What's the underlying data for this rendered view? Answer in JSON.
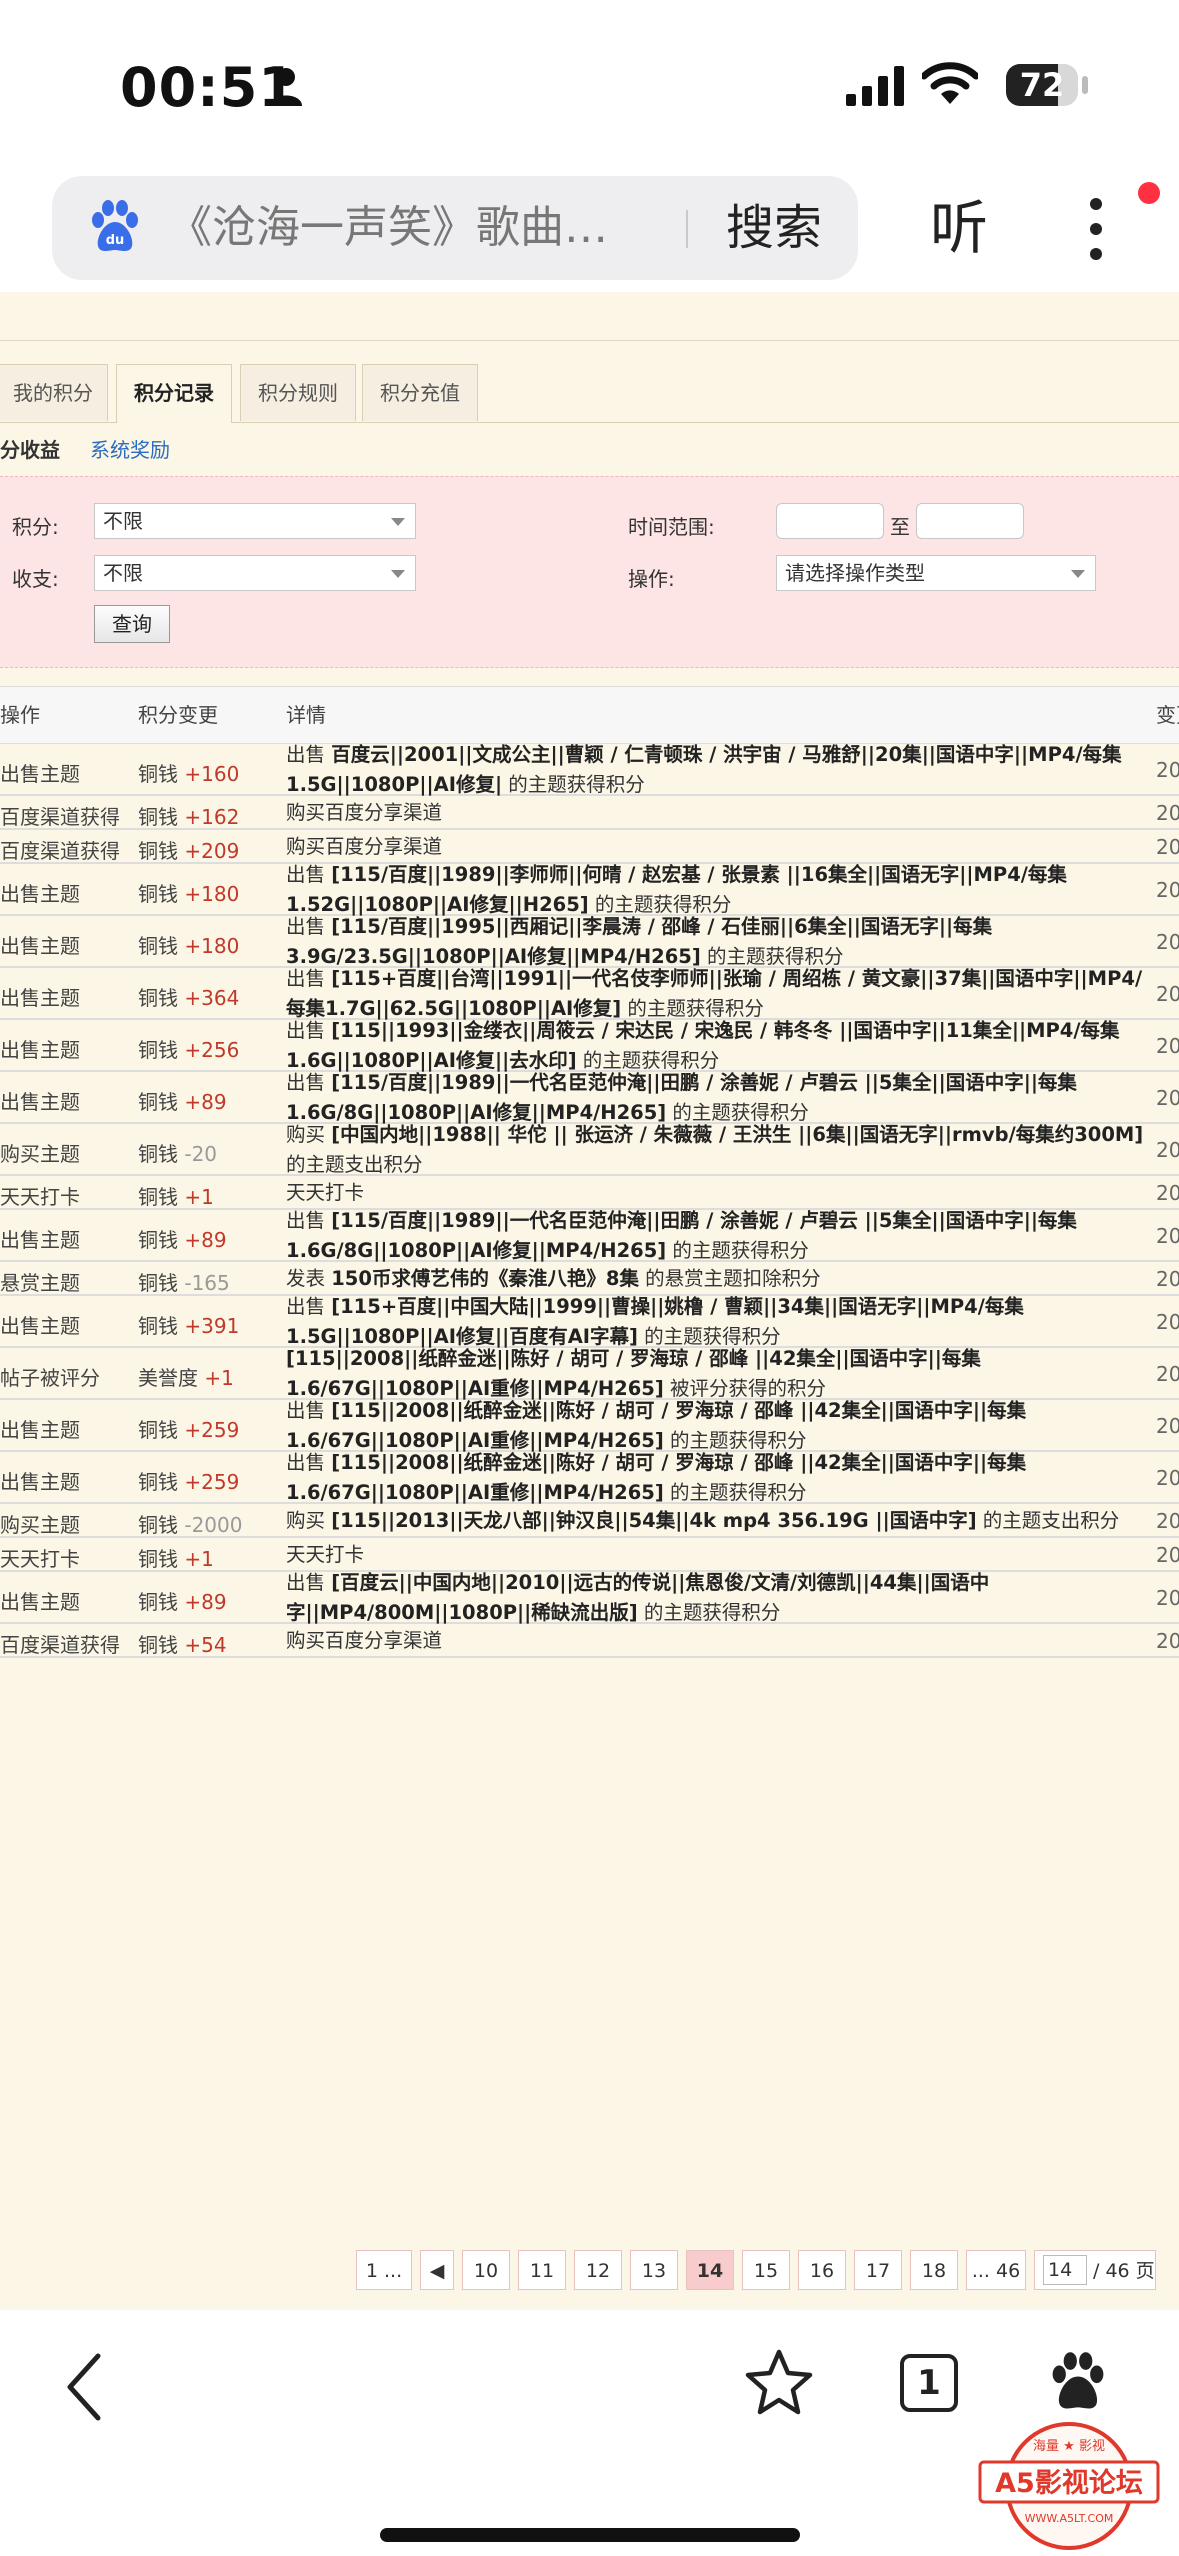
{
  "status_bar": {
    "time": "00:51",
    "battery": "72",
    "battery_level": 0.72
  },
  "browser": {
    "search_query": "《沧海一声笑》歌曲…",
    "search_button": "搜索",
    "listen_button": "听",
    "tab_count": "1"
  },
  "tabs": [
    {
      "label": "我的积分"
    },
    {
      "label": "积分记录"
    },
    {
      "label": "积分规则"
    },
    {
      "label": "积分充值"
    }
  ],
  "subtabs": {
    "income": "分收益",
    "system_reward": "系统奖励"
  },
  "filters": {
    "score_label": "积分:",
    "score_value": "不限",
    "inout_label": "收支:",
    "inout_value": "不限",
    "time_range_label": "时间范围:",
    "time_to": "至",
    "operation_label": "操作:",
    "operation_value": "请选择操作类型",
    "query_button": "查询"
  },
  "table": {
    "headers": {
      "op": "操作",
      "change": "积分变更",
      "detail": "详情",
      "time": "变更"
    },
    "rows": [
      {
        "op": "出售主题",
        "currency": "铜钱",
        "amount": "+160",
        "detail": "出售 <b>百度云||2001||文成公主||曹颖 / 仁青顿珠 / 洪宇宙 / 马雅舒||20集||国语中字||MP4/每集1.5G||1080P||AI修复|</b> 的主题获得积分",
        "year": "20"
      },
      {
        "op": "百度渠道获得",
        "currency": "铜钱",
        "amount": "+162",
        "detail": "购买百度分享渠道",
        "year": "20"
      },
      {
        "op": "百度渠道获得",
        "currency": "铜钱",
        "amount": "+209",
        "detail": "购买百度分享渠道",
        "year": "20"
      },
      {
        "op": "出售主题",
        "currency": "铜钱",
        "amount": "+180",
        "detail": "出售 <b>[115/百度||1989||李师师||何晴 / 赵宏基 / 张景素 ||16集全||国语无字||MP4/每集1.52G||1080P||AI修复||H265]</b> 的主题获得积分",
        "year": "20"
      },
      {
        "op": "出售主题",
        "currency": "铜钱",
        "amount": "+180",
        "detail": "出售 <b>[115/百度||1995||西厢记||李晨涛 / 邵峰 / 石佳丽||6集全||国语无字||每集3.9G/23.5G||1080P||AI修复||MP4/H265]</b> 的主题获得积分",
        "year": "20"
      },
      {
        "op": "出售主题",
        "currency": "铜钱",
        "amount": "+364",
        "detail": "出售 <b>[115+百度||台湾||1991||一代名伎李师师||张瑜 / 周绍栋 / 黄文豪||37集||国语中字||MP4/每集1.7G||62.5G||1080P||AI修复]</b> 的主题获得积分",
        "year": "20"
      },
      {
        "op": "出售主题",
        "currency": "铜钱",
        "amount": "+256",
        "detail": "出售 <b>[115||1993||金缕衣||周筱云 / 宋达民 / 宋逸民 / 韩冬冬 ||国语中字||11集全||MP4/每集1.6G||1080P||AI修复||去水印]</b> 的主题获得积分",
        "year": "20"
      },
      {
        "op": "出售主题",
        "currency": "铜钱",
        "amount": "+89",
        "detail": "出售 <b>[115/百度||1989||一代名臣范仲淹||田鹏 / 涂善妮 / 卢碧云 ||5集全||国语中字||每集1.6G/8G||1080P||AI修复||MP4/H265]</b> 的主题获得积分",
        "year": "20"
      },
      {
        "op": "购买主题",
        "currency": "铜钱",
        "amount": "-20",
        "detail": "购买 <b>[中国内地||1988|| 华佗 || 张运济 / 朱薇薇 / 王洪生 ||6集||国语无字||rmvb/每集约300M]</b> 的主题支出积分",
        "year": "20"
      },
      {
        "op": "天天打卡",
        "currency": "铜钱",
        "amount": "+1",
        "detail": "天天打卡",
        "year": "20"
      },
      {
        "op": "出售主题",
        "currency": "铜钱",
        "amount": "+89",
        "detail": "出售 <b>[115/百度||1989||一代名臣范仲淹||田鹏 / 涂善妮 / 卢碧云 ||5集全||国语中字||每集1.6G/8G||1080P||AI修复||MP4/H265]</b> 的主题获得积分",
        "year": "20"
      },
      {
        "op": "悬赏主题",
        "currency": "铜钱",
        "amount": "-165",
        "detail": "发表 <b>150币求傅艺伟的《秦淮八艳》8集</b> 的悬赏主题扣除积分",
        "year": "20"
      },
      {
        "op": "出售主题",
        "currency": "铜钱",
        "amount": "+391",
        "detail": "出售 <b>[115+百度||中国大陆||1999||曹操||姚橹 / 曹颖||34集||国语无字||MP4/每集1.5G||1080P||AI修复||百度有AI字幕]</b> 的主题获得积分",
        "year": "20"
      },
      {
        "op": "帖子被评分",
        "currency": "美誉度",
        "amount": "+1",
        "detail": "<b>[115||2008||纸醉金迷||陈好 / 胡可 / 罗海琼 / 邵峰 ||42集全||国语中字||每集1.6/67G||1080P||AI重修||MP4/H265]</b> 被评分获得的积分",
        "year": "20"
      },
      {
        "op": "出售主题",
        "currency": "铜钱",
        "amount": "+259",
        "detail": "出售 <b>[115||2008||纸醉金迷||陈好 / 胡可 / 罗海琼 / 邵峰 ||42集全||国语中字||每集1.6/67G||1080P||AI重修||MP4/H265]</b> 的主题获得积分",
        "year": "20"
      },
      {
        "op": "出售主题",
        "currency": "铜钱",
        "amount": "+259",
        "detail": "出售 <b>[115||2008||纸醉金迷||陈好 / 胡可 / 罗海琼 / 邵峰 ||42集全||国语中字||每集1.6/67G||1080P||AI重修||MP4/H265]</b> 的主题获得积分",
        "year": "20"
      },
      {
        "op": "购买主题",
        "currency": "铜钱",
        "amount": "-2000",
        "detail": "购买 <b>[115||2013||天龙八部||钟汉良||54集||4k mp4 356.19G ||国语中字]</b> 的主题支出积分",
        "year": "20"
      },
      {
        "op": "天天打卡",
        "currency": "铜钱",
        "amount": "+1",
        "detail": "天天打卡",
        "year": "20"
      },
      {
        "op": "出售主题",
        "currency": "铜钱",
        "amount": "+89",
        "detail": "出售 <b>[百度云||中国内地||2010||远古的传说||焦恩俊/文清/刘德凯||44集||国语中字||MP4/800M||1080P||稀缺流出版]</b> 的主题获得积分",
        "year": "20"
      },
      {
        "op": "百度渠道获得",
        "currency": "铜钱",
        "amount": "+54",
        "detail": "购买百度分享渠道",
        "year": "20"
      }
    ]
  },
  "pagination": {
    "pages": [
      "1 ...",
      "◀",
      "10",
      "11",
      "12",
      "13",
      "14",
      "15",
      "16",
      "17",
      "18",
      "... 46"
    ],
    "current": "14",
    "input_value": "14",
    "total": "/ 46 页"
  },
  "watermark": {
    "line1": "海量 ★ 影视",
    "brand": "A5影视论坛",
    "url": "WWW.A5LT.COM"
  }
}
